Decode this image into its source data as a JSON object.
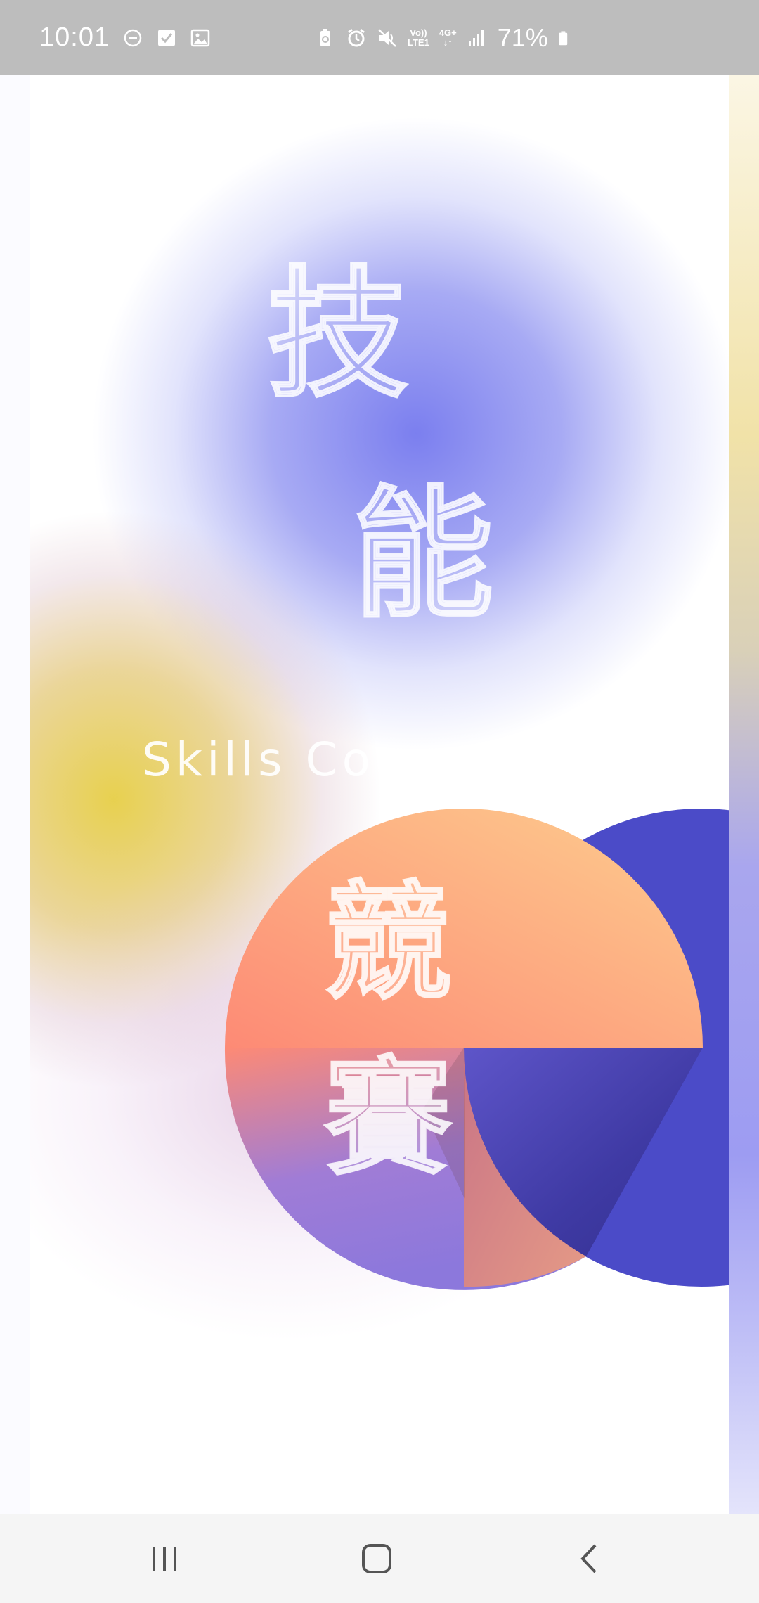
{
  "status_bar": {
    "time": "10:01",
    "icons_left": [
      "do-not-disturb-icon",
      "checkbox-icon",
      "gallery-icon"
    ],
    "icons_right": [
      "battery-saver-icon",
      "alarm-icon",
      "mute-icon",
      "volte-icon",
      "4g-data-icon",
      "signal-icon"
    ],
    "volte_label_top": "Vo))",
    "volte_label_bottom": "LTE1",
    "network_label_top": "4G+",
    "network_label_bottom": "↓↑",
    "battery_percent": "71%"
  },
  "splash": {
    "title_chars": [
      "技",
      "能",
      "競",
      "賽"
    ],
    "subtitle": "Skills Competition",
    "colors": {
      "blue_blob": "#7f82ee",
      "yellow_blob": "#e6cf46",
      "indigo_circle": "#4b4bc8",
      "peach": "#fdc58c",
      "coral": "#fd8a75",
      "violet": "#9a7dd8"
    }
  },
  "nav_bar": {
    "buttons": [
      "recent-apps-icon",
      "home-icon",
      "back-icon"
    ]
  }
}
